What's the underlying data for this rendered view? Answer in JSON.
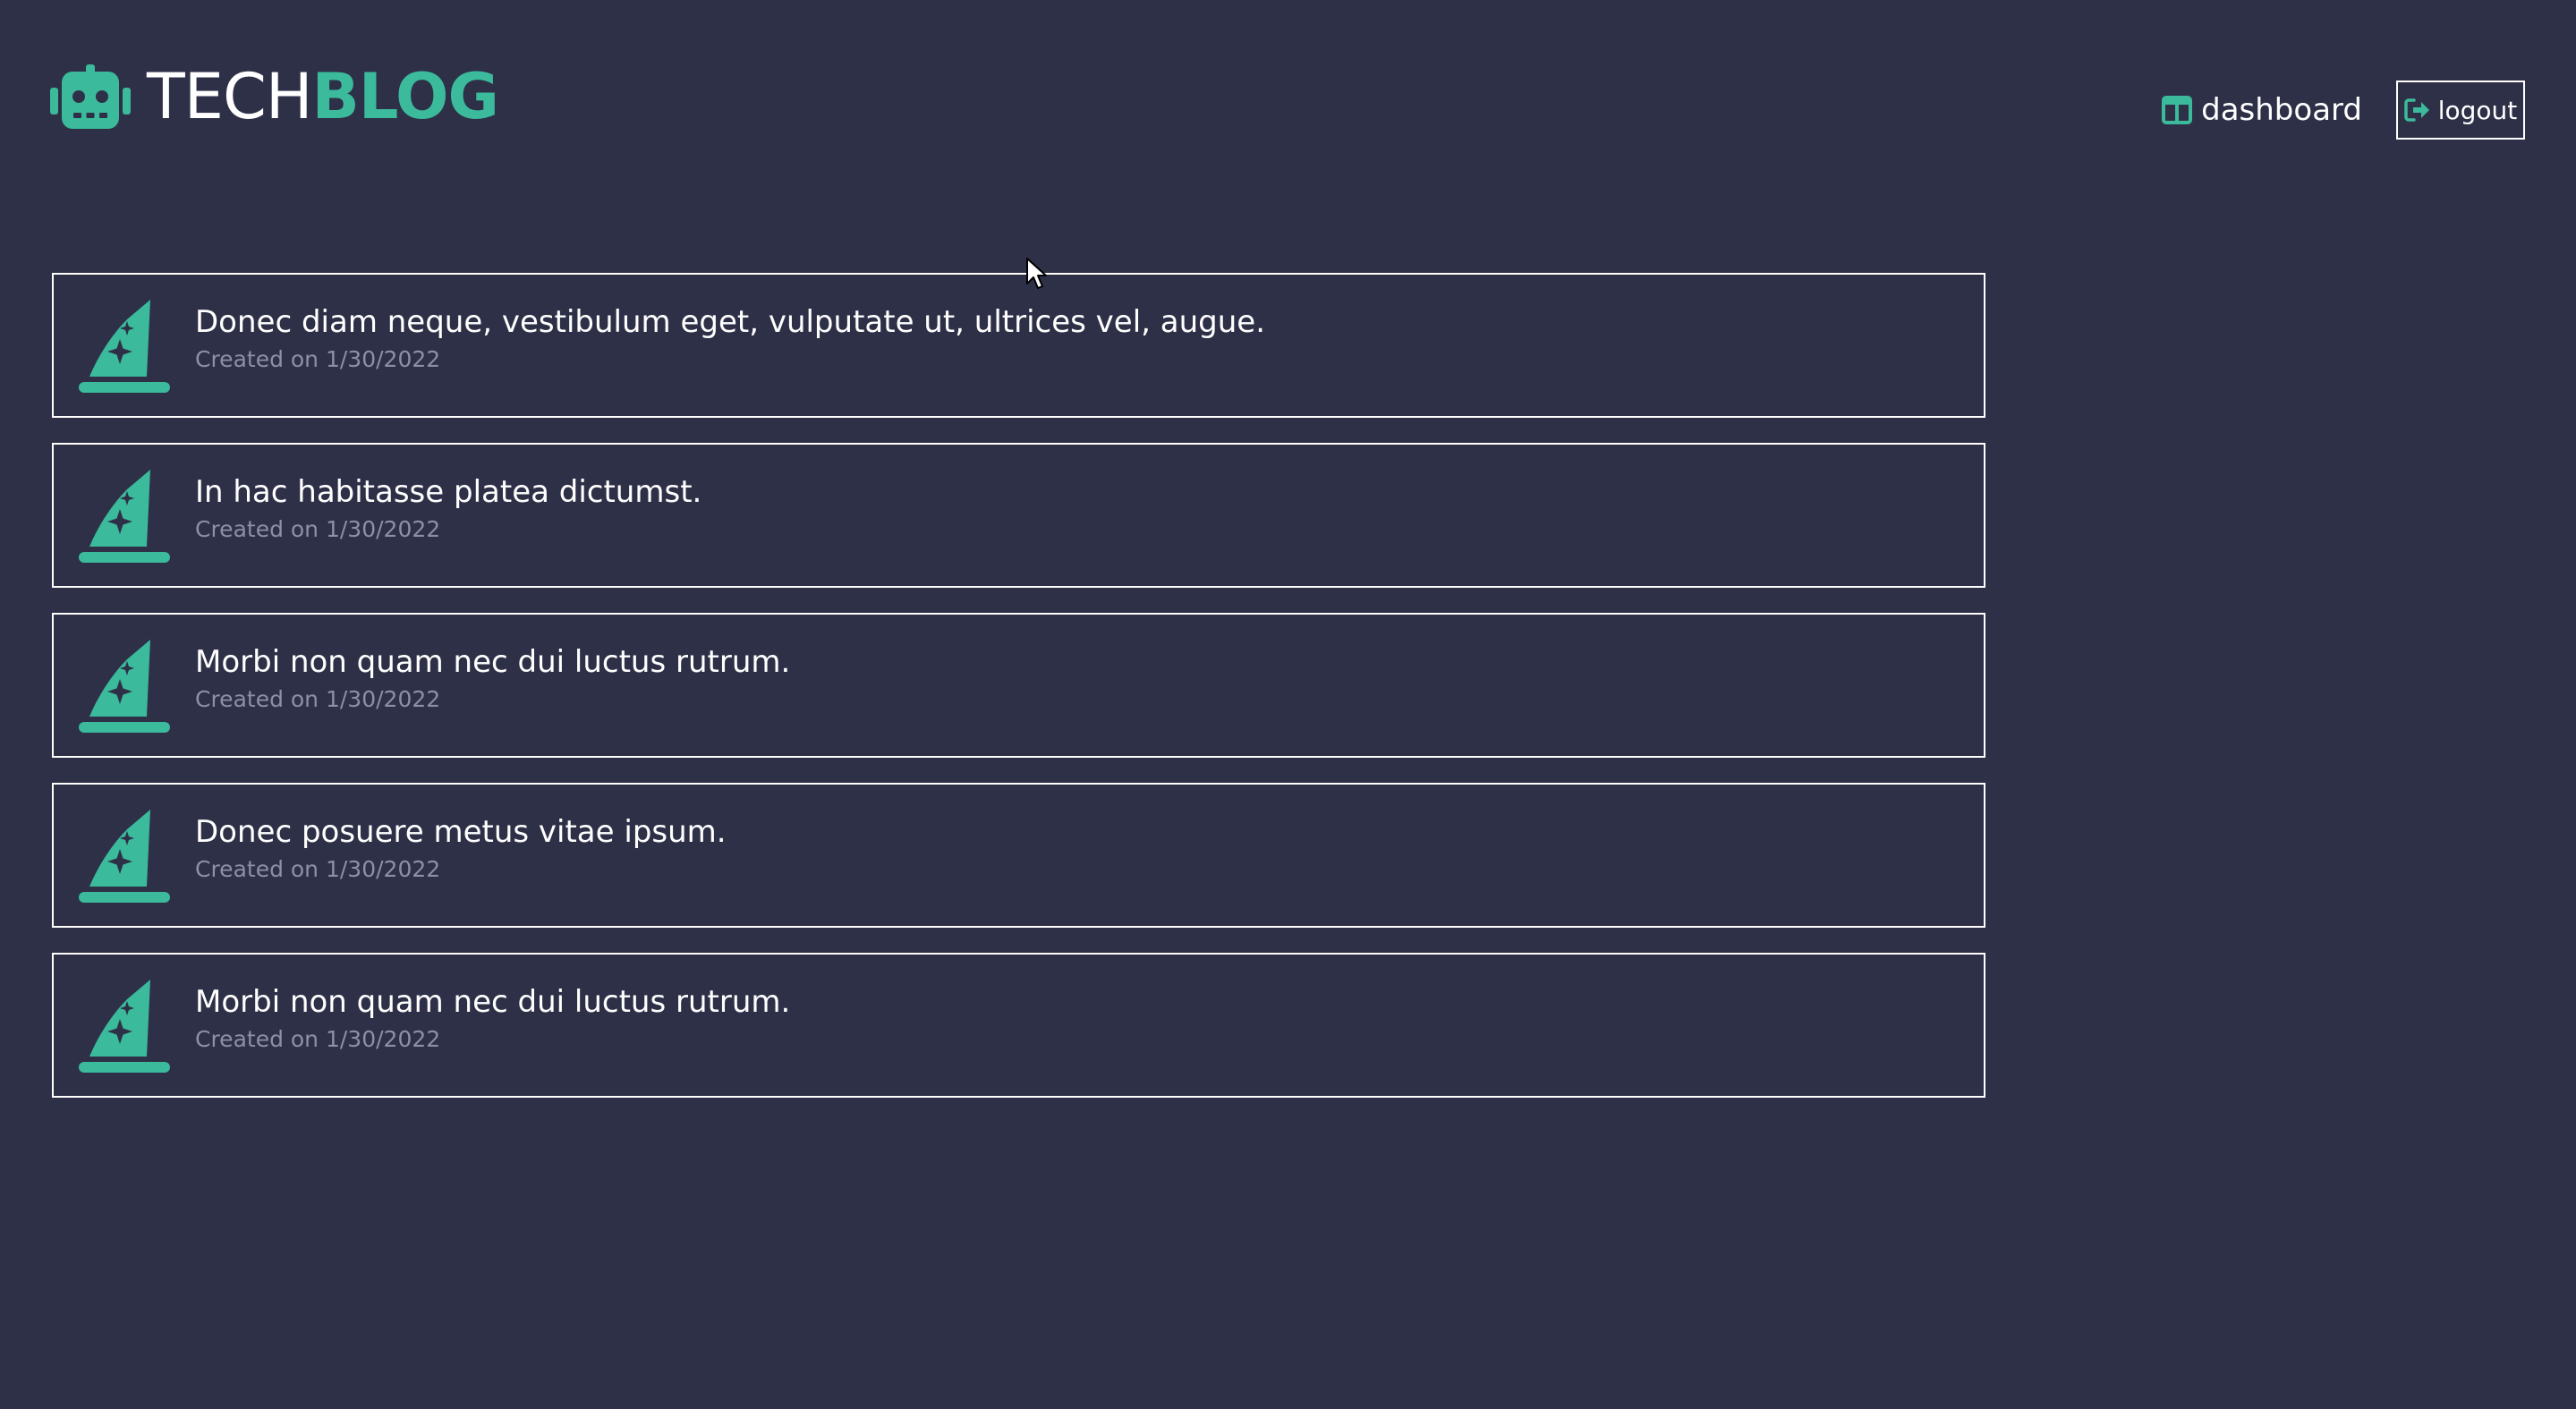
{
  "header": {
    "brand_part1": "TECH",
    "brand_part2": "BLOG",
    "brand_icon": "robot-icon",
    "nav": {
      "dashboard_label": "dashboard",
      "dashboard_icon": "columns-icon",
      "logout_label": "logout",
      "logout_icon": "sign-out-icon"
    }
  },
  "posts": [
    {
      "title": "Donec diam neque, vestibulum eget, vulputate ut, ultrices vel, augue.",
      "date": "Created on 1/30/2022",
      "icon": "wizard-hat-icon"
    },
    {
      "title": "In hac habitasse platea dictumst.",
      "date": "Created on 1/30/2022",
      "icon": "wizard-hat-icon"
    },
    {
      "title": "Morbi non quam nec dui luctus rutrum.",
      "date": "Created on 1/30/2022",
      "icon": "wizard-hat-icon"
    },
    {
      "title": "Donec posuere metus vitae ipsum.",
      "date": "Created on 1/30/2022",
      "icon": "wizard-hat-icon"
    },
    {
      "title": "Morbi non quam nec dui luctus rutrum.",
      "date": "Created on 1/30/2022",
      "icon": "wizard-hat-icon"
    }
  ],
  "colors": {
    "background": "#2e3047",
    "accent": "#3bba9c",
    "border": "#ffffff",
    "muted_text": "#8c8fa6"
  }
}
